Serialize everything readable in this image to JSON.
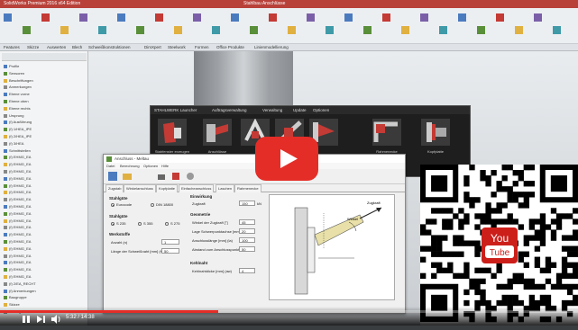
{
  "app": {
    "window_title": "SolidWorks Premium 2016 x64 Edition",
    "center_title": "Stahlbau Anschlüsse"
  },
  "ribbon_tabs": [
    "Features",
    "Skizze",
    "Auswerten",
    "Blech",
    "Schweißkonstruktionen",
    "DimXpert",
    "Steelwork",
    "Formen",
    "Office Produkte",
    "Linienmodellierung"
  ],
  "tree": {
    "items": [
      "Profile",
      "Sensoren",
      "Beschriftungen",
      "Anmerkungen",
      "Ebene vorne",
      "Ebene oben",
      "Ebene rechts",
      "Ursprung",
      "(f) Ausführung",
      "(f) 1/HEA_IPE",
      "(f) 2/HEA_IPE",
      "(f) 3/HEA",
      "Schnittstellen",
      "(f) EHMG_EA",
      "(f) EHMG_EA",
      "(f) EHMG_EA",
      "(f) EHMG_EA",
      "(f) EHMG_EA",
      "(f) EHMG_EA",
      "(f) EHMG_EA",
      "(f) EHMG_EA",
      "(f) EHMG_EA",
      "(f) EHMG_EA",
      "(f) EHMG_EA",
      "(f) EHMG_EA",
      "(f) EHMG_EA",
      "(f) EHMG_EA",
      "(f) EHMG_EA",
      "(f) EHMG_EA",
      "(f) EHMG_EA",
      "(f) EHMG_EA",
      "(f) 2/EA_RECHT",
      "(f) Anmerkungen",
      "Baugruppe",
      "Skizze",
      "Lösungen"
    ]
  },
  "launcher": {
    "menu": [
      "STAHLWERK Launcher",
      "Auftragsverwaltung",
      "Verwaltung",
      "Update",
      "Optionen"
    ],
    "tiles": [
      "Stabfenster erzeugen",
      "Anschlüsse",
      "",
      "",
      "",
      "Rahmenecke",
      "Kopfplatte"
    ]
  },
  "calc": {
    "title": "Anschluss - Meltau",
    "menubar": [
      "Datei",
      "Berechnung",
      "Optionen",
      "Hilfe"
    ],
    "tabs": [
      "Zugstab",
      "Winkelanschluss",
      "Kopfplatte",
      "Einfacheanschluss",
      "Laschen",
      "Rahmenecke"
    ],
    "norm_header": "Stahlgüte",
    "norm_options": [
      "Eurocode",
      "DIN 18800"
    ],
    "norm_selected": "Eurocode",
    "grade_header": "Stahlgüte",
    "grades": [
      "S 235",
      "S 355",
      "S 275"
    ],
    "grade_selected": "S 235",
    "material_header": "Werkstoffe",
    "anzahl_label": "Anzahl (n)",
    "anzahl_value": "1",
    "laenge_label": "Länge der Schweißnaht [mm] (lw)",
    "laenge_value": "50",
    "einwirkung_header": "Einwirkung",
    "zugkraft_label": "Zugkraft",
    "zugkraft_value": "150",
    "zugkraft_unit": "kN",
    "geometrie_header": "Geometrie",
    "geometrie_rows": [
      {
        "label": "Winkel der Zugkraft [°]",
        "value": "45"
      },
      {
        "label": "Lage Schwerpunktachse [mm] (e)",
        "value": "20"
      },
      {
        "label": "Anschlusslänge [mm] (la)",
        "value": "100"
      },
      {
        "label": "Abstand zum Anschlusspunkt [mm] (x)",
        "value": "50"
      }
    ],
    "kehlnaht_header": "Kehlnaht",
    "kehlnaht_label": "Kehlnahtdicke [mm] (aw)",
    "kehlnaht_value": "4",
    "diagram_labels": [
      "Zugkraft",
      "Winkel"
    ]
  },
  "player": {
    "current_time": "5:32",
    "duration": "14:38",
    "time_text": "5:32 / 14:38",
    "progress_fraction": 0.378
  },
  "qr": {
    "badge_top": "You",
    "badge_bottom": "Tube"
  },
  "colors": {
    "titlebar": "#b8413a",
    "youtube_red": "#e52d27",
    "qr_badge": "#cc1f1a"
  }
}
